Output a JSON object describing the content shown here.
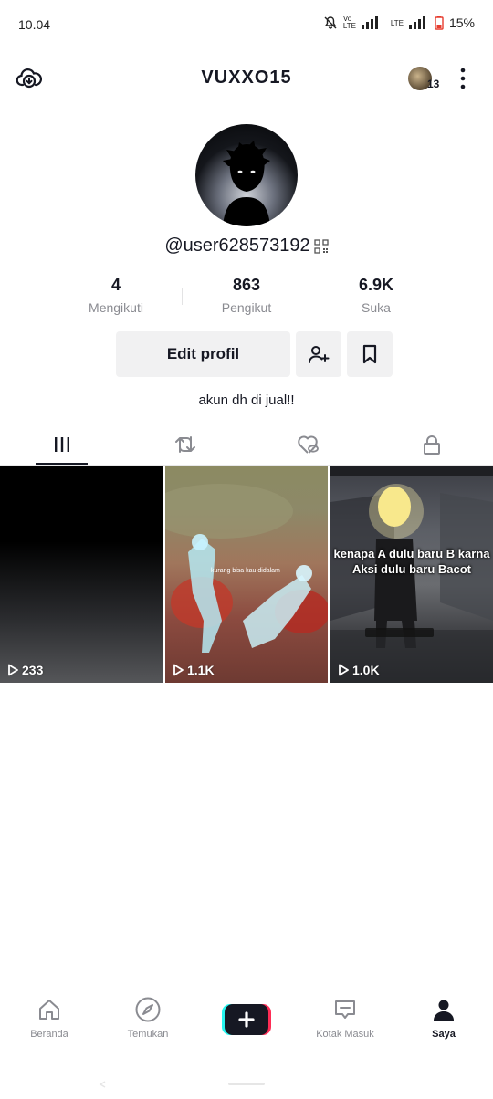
{
  "status": {
    "time": "10.04",
    "network1": "Vo LTE",
    "network2": "LTE",
    "battery": "15%"
  },
  "header": {
    "title": "VUXXO15",
    "friend_count": "13"
  },
  "profile": {
    "username": "@user628573192",
    "bio": "akun dh di jual!!"
  },
  "stats": [
    {
      "value": "4",
      "label": "Mengikuti"
    },
    {
      "value": "863",
      "label": "Pengikut"
    },
    {
      "value": "6.9K",
      "label": "Suka"
    }
  ],
  "actions": {
    "edit_label": "Edit profil"
  },
  "tabs": [
    {
      "icon": "grid-icon",
      "active": true
    },
    {
      "icon": "repost-icon",
      "active": false
    },
    {
      "icon": "liked-icon",
      "active": false
    },
    {
      "icon": "lock-icon",
      "active": false
    }
  ],
  "videos": [
    {
      "views": "233",
      "caption": "",
      "overlay_text": ""
    },
    {
      "views": "1.1K",
      "caption": "",
      "overlay_text": "kurang bisa kau didalam"
    },
    {
      "views": "1.0K",
      "caption": "kenapa A dulu baru B karna Aksi dulu baru Bacot",
      "overlay_text": ""
    }
  ],
  "nav": [
    {
      "label": "Beranda",
      "icon": "home-icon",
      "active": false
    },
    {
      "label": "Temukan",
      "icon": "compass-icon",
      "active": false
    },
    {
      "label": "",
      "icon": "plus-icon",
      "active": false
    },
    {
      "label": "Kotak Masuk",
      "icon": "inbox-icon",
      "active": false
    },
    {
      "label": "Saya",
      "icon": "profile-icon",
      "active": true
    }
  ]
}
